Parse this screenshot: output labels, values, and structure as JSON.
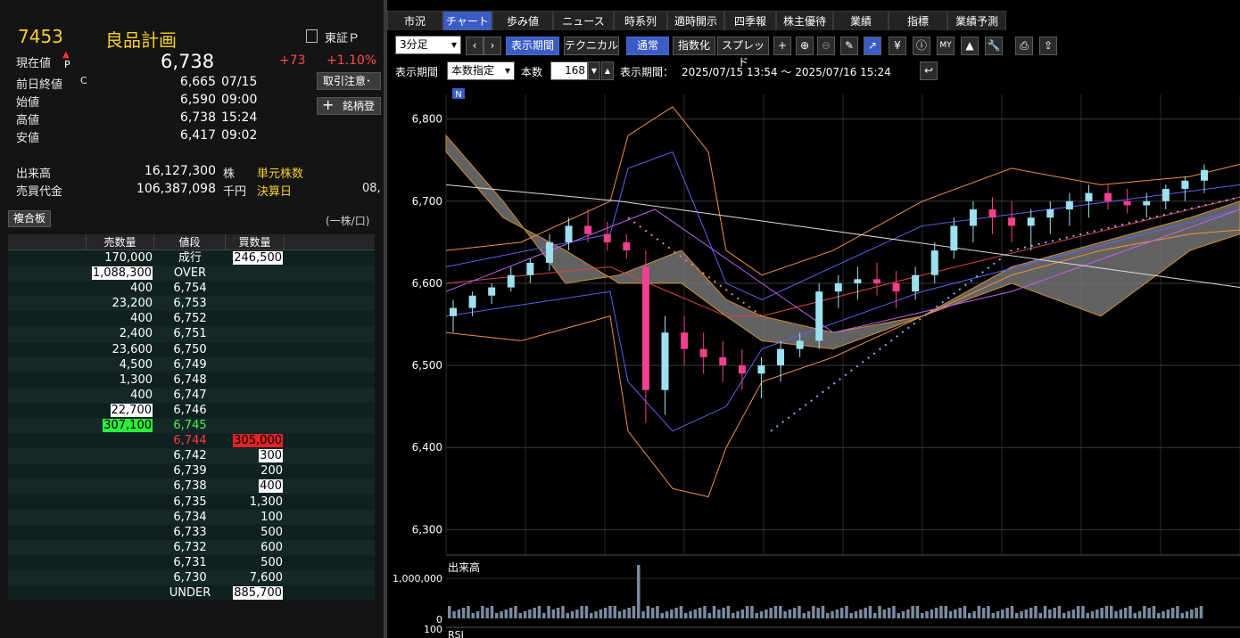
{
  "header": {
    "code": "7453",
    "name": "良品計画",
    "exchange": "東証Ｐ",
    "current_label": "現在値",
    "current_mark": "P",
    "current_value": "6,738",
    "change": "+73",
    "change_pct": "+1.10%"
  },
  "quotes": [
    {
      "label": "前日終値",
      "mark": "C",
      "value": "6,665",
      "time": "07/15"
    },
    {
      "label": "始値",
      "mark": "",
      "value": "6,590",
      "time": "09:00"
    },
    {
      "label": "高値",
      "mark": "",
      "value": "6,738",
      "time": "15:24"
    },
    {
      "label": "安値",
      "mark": "",
      "value": "6,417",
      "time": "09:02"
    }
  ],
  "volume": {
    "label": "出来高",
    "value": "16,127,300",
    "unit": "株",
    "label2": "単元株数"
  },
  "turnover": {
    "label": "売買代金",
    "value": "106,387,098",
    "unit": "千円",
    "label2": "決算日",
    "value2": "08,"
  },
  "buttons": {
    "caution": "取引注意･",
    "register": "銘柄登",
    "plus": "+",
    "fukugo": "複合板",
    "unit_note": "(一株/口)"
  },
  "board": {
    "headers": [
      "売数量",
      "値段",
      "買数量"
    ],
    "rows": [
      {
        "sell": "170,000",
        "price": "成行",
        "buy": "246,500",
        "sh": "",
        "bh": "w",
        "pc": ""
      },
      {
        "sell": "1,088,300",
        "price": "OVER",
        "buy": "",
        "sh": "w",
        "bh": "",
        "pc": ""
      },
      {
        "sell": "400",
        "price": "6,754",
        "buy": "",
        "sh": "",
        "bh": "",
        "pc": ""
      },
      {
        "sell": "23,200",
        "price": "6,753",
        "buy": "",
        "sh": "",
        "bh": "",
        "pc": ""
      },
      {
        "sell": "400",
        "price": "6,752",
        "buy": "",
        "sh": "",
        "bh": "",
        "pc": ""
      },
      {
        "sell": "2,400",
        "price": "6,751",
        "buy": "",
        "sh": "",
        "bh": "",
        "pc": ""
      },
      {
        "sell": "23,600",
        "price": "6,750",
        "buy": "",
        "sh": "",
        "bh": "",
        "pc": ""
      },
      {
        "sell": "4,500",
        "price": "6,749",
        "buy": "",
        "sh": "",
        "bh": "",
        "pc": ""
      },
      {
        "sell": "1,300",
        "price": "6,748",
        "buy": "",
        "sh": "",
        "bh": "",
        "pc": ""
      },
      {
        "sell": "400",
        "price": "6,747",
        "buy": "",
        "sh": "",
        "bh": "",
        "pc": ""
      },
      {
        "sell": "22,700",
        "price": "6,746",
        "buy": "",
        "sh": "w",
        "bh": "",
        "pc": ""
      },
      {
        "sell": "307,100",
        "price": "6,745",
        "buy": "",
        "sh": "g",
        "bh": "",
        "pc": "g"
      },
      {
        "sell": "",
        "price": "6,744",
        "buy": "305,000",
        "sh": "",
        "bh": "r",
        "pc": "r"
      },
      {
        "sell": "",
        "price": "6,742",
        "buy": "300",
        "sh": "",
        "bh": "w",
        "pc": ""
      },
      {
        "sell": "",
        "price": "6,739",
        "buy": "200",
        "sh": "",
        "bh": "",
        "pc": ""
      },
      {
        "sell": "",
        "price": "6,738",
        "buy": "400",
        "sh": "",
        "bh": "w",
        "pc": ""
      },
      {
        "sell": "",
        "price": "6,735",
        "buy": "1,300",
        "sh": "",
        "bh": "",
        "pc": ""
      },
      {
        "sell": "",
        "price": "6,734",
        "buy": "100",
        "sh": "",
        "bh": "",
        "pc": ""
      },
      {
        "sell": "",
        "price": "6,733",
        "buy": "500",
        "sh": "",
        "bh": "",
        "pc": ""
      },
      {
        "sell": "",
        "price": "6,732",
        "buy": "600",
        "sh": "",
        "bh": "",
        "pc": ""
      },
      {
        "sell": "",
        "price": "6,731",
        "buy": "500",
        "sh": "",
        "bh": "",
        "pc": ""
      },
      {
        "sell": "",
        "price": "6,730",
        "buy": "7,600",
        "sh": "",
        "bh": "",
        "pc": ""
      },
      {
        "sell": "",
        "price": "UNDER",
        "buy": "885,700",
        "sh": "",
        "bh": "w",
        "pc": ""
      }
    ]
  },
  "tabs": [
    "市況",
    "チャート",
    "歩み値",
    "ニュース",
    "時系列",
    "適時開示",
    "四季報",
    "株主優待",
    "業績",
    "指標",
    "業績予測"
  ],
  "active_tab": 1,
  "toolbar": {
    "interval": "3分足",
    "period_btn": "表示期間",
    "technical_btn": "テクニカル",
    "normal_btn": "通常",
    "index_btn": "指数化",
    "spread_btn": "スプレッド"
  },
  "toolbar2": {
    "period_label": "表示期間",
    "period_mode": "本数指定",
    "count_label": "本数",
    "count_value": "168",
    "range_label": "表示期間：",
    "range_value": "2025/07/15 13:54 ～ 2025/07/16 15:24"
  },
  "chart_badge": "N",
  "chart_data": {
    "type": "candlestick",
    "yticks": [
      "6,800",
      "6,700",
      "6,600",
      "6,500",
      "6,400",
      "6,300"
    ],
    "ylim": [
      6270,
      6830
    ],
    "volume_label": "出来高",
    "volume_tick": "1,000,000",
    "volume_zero": "0",
    "rsi_tick": "100",
    "rsi_label": "RSI",
    "candles_ohlc": [
      [
        6560,
        6580,
        6540,
        6570
      ],
      [
        6570,
        6590,
        6560,
        6585
      ],
      [
        6585,
        6600,
        6575,
        6595
      ],
      [
        6595,
        6620,
        6590,
        6610
      ],
      [
        6610,
        6630,
        6600,
        6625
      ],
      [
        6625,
        6660,
        6615,
        6650
      ],
      [
        6650,
        6680,
        6640,
        6670
      ],
      [
        6670,
        6690,
        6650,
        6660
      ],
      [
        6660,
        6675,
        6640,
        6650
      ],
      [
        6650,
        6660,
        6630,
        6640
      ],
      [
        6620,
        6640,
        6430,
        6470
      ],
      [
        6470,
        6560,
        6440,
        6540
      ],
      [
        6540,
        6560,
        6500,
        6520
      ],
      [
        6520,
        6540,
        6490,
        6510
      ],
      [
        6510,
        6530,
        6480,
        6500
      ],
      [
        6500,
        6520,
        6470,
        6490
      ],
      [
        6490,
        6510,
        6460,
        6500
      ],
      [
        6500,
        6530,
        6480,
        6520
      ],
      [
        6520,
        6540,
        6510,
        6530
      ],
      [
        6530,
        6600,
        6520,
        6590
      ],
      [
        6590,
        6610,
        6570,
        6600
      ],
      [
        6600,
        6620,
        6580,
        6605
      ],
      [
        6605,
        6625,
        6585,
        6600
      ],
      [
        6600,
        6615,
        6570,
        6590
      ],
      [
        6590,
        6620,
        6580,
        6610
      ],
      [
        6610,
        6650,
        6600,
        6640
      ],
      [
        6640,
        6680,
        6630,
        6670
      ],
      [
        6670,
        6700,
        6650,
        6690
      ],
      [
        6690,
        6705,
        6660,
        6680
      ],
      [
        6680,
        6700,
        6650,
        6670
      ],
      [
        6670,
        6690,
        6640,
        6680
      ],
      [
        6680,
        6700,
        6660,
        6690
      ],
      [
        6690,
        6710,
        6670,
        6700
      ],
      [
        6700,
        6720,
        6680,
        6710
      ],
      [
        6710,
        6720,
        6690,
        6700
      ],
      [
        6700,
        6715,
        6685,
        6695
      ],
      [
        6695,
        6710,
        6680,
        6700
      ],
      [
        6700,
        6720,
        6690,
        6715
      ],
      [
        6715,
        6730,
        6700,
        6725
      ],
      [
        6725,
        6745,
        6710,
        6738
      ]
    ]
  }
}
